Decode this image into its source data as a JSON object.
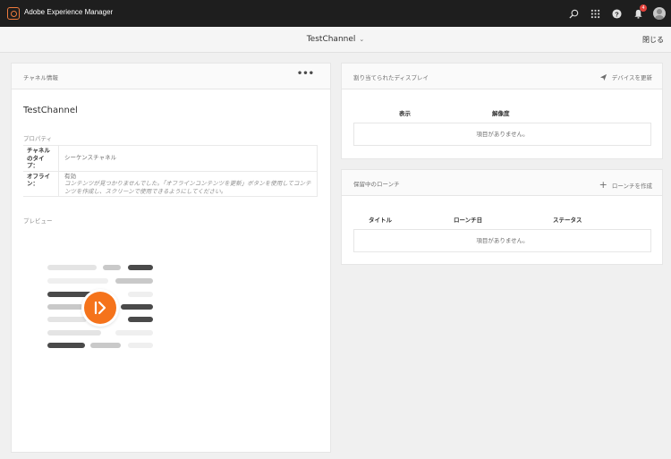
{
  "shell": {
    "app_title": "Adobe Experience Manager",
    "notification_count": "4",
    "icons": [
      "search-icon",
      "apps-grid-icon",
      "help-icon",
      "bell-icon",
      "user-avatar"
    ]
  },
  "subbar": {
    "channel_title": "TestChannel",
    "chevron": "⌄",
    "close_label": "閉じる"
  },
  "channel_info": {
    "panel_title": "チャネル情報",
    "more_label": "•••",
    "name": "TestChannel",
    "properties_label": "プロパティ",
    "properties": [
      {
        "key": "チャネルのタイプ：",
        "value": "シーケンスチャネル"
      },
      {
        "key": "オフライン：",
        "value": "有効",
        "note": "コンテンツが見つかりませんでした。「オフラインコンテンツを更新」ボタンを使用してコンテンツを作成し、スクリーンで使用できるようにしてください。"
      }
    ],
    "preview_label": "プレビュー"
  },
  "displays": {
    "panel_title": "割り当てられたディスプレイ",
    "action_label": "デバイスを更新",
    "columns": [
      "表示",
      "解像度"
    ],
    "empty_text": "項目がありません。"
  },
  "launches": {
    "panel_title": "保留中のローンチ",
    "action_label": "ローンチを作成",
    "action_icon": "+",
    "columns": [
      "タイトル",
      "ローンチ日",
      "ステータス"
    ],
    "empty_text": "項目がありません。"
  },
  "colors": {
    "shell_bg": "#1e1e1e",
    "accent_orange": "#f5731b",
    "logo_orange": "#ee7b3d",
    "badge_red": "#e3413b"
  }
}
